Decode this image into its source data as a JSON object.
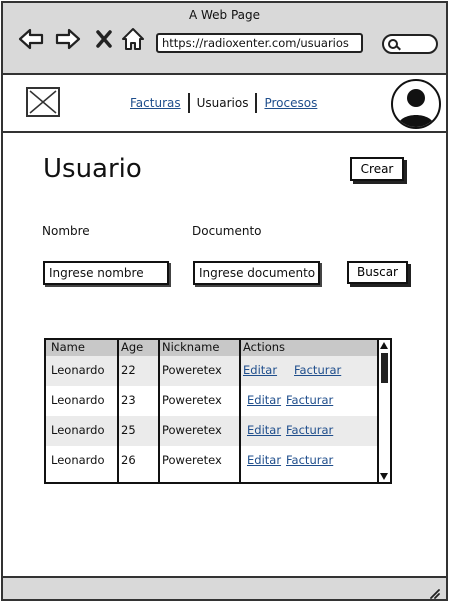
{
  "window": {
    "title": "A Web Page"
  },
  "browser": {
    "url": "https://radioxenter.com/usuarios"
  },
  "nav": {
    "links": [
      {
        "label": "Facturas"
      },
      {
        "label": "Usuarios"
      },
      {
        "label": "Procesos"
      }
    ]
  },
  "page": {
    "title": "Usuario",
    "create_label": "Crear"
  },
  "form": {
    "name_label": "Nombre",
    "name_placeholder": "Ingrese nombre",
    "doc_label": "Documento",
    "doc_placeholder": "Ingrese documento",
    "search_label": "Buscar"
  },
  "table": {
    "headers": [
      "Name",
      "Age",
      "Nickname",
      "Actions"
    ],
    "rows": [
      {
        "name": "Leonardo",
        "age": "22",
        "nickname": "Poweretex",
        "edit": "Editar",
        "invoice": "Facturar"
      },
      {
        "name": "Leonardo",
        "age": "23",
        "nickname": "Poweretex",
        "edit": "Editar",
        "invoice": "Facturar"
      },
      {
        "name": "Leonardo",
        "age": "25",
        "nickname": "Poweretex",
        "edit": "Editar",
        "invoice": "Facturar"
      },
      {
        "name": "Leonardo",
        "age": "26",
        "nickname": "Poweretex",
        "edit": "Editar",
        "invoice": "Facturar"
      }
    ]
  },
  "colors": {
    "link": "#1f4e8c",
    "chrome": "#d9d9d9",
    "table_header": "#c8c8c8",
    "row_alt": "#ebebeb"
  },
  "icons": [
    "back-arrow-icon",
    "forward-arrow-icon",
    "close-icon",
    "home-icon",
    "search-icon",
    "logo-placeholder-icon",
    "user-avatar-icon",
    "resize-grip-icon"
  ]
}
